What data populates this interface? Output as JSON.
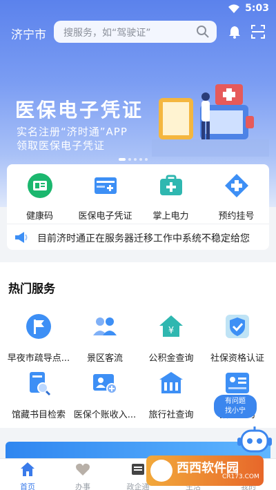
{
  "status_bar": {
    "time": "5:03"
  },
  "header": {
    "city": "济宁市",
    "search_placeholder": "搜服务，如“驾驶证”"
  },
  "banner": {
    "title": "医保电子凭证",
    "line1": "实名注册“济时通”APP",
    "line2": "领取医保电子凭证"
  },
  "quick_actions": [
    {
      "label": "健康码",
      "icon": "health-code-icon",
      "color": "#1bb76e"
    },
    {
      "label": "医保电子凭证",
      "icon": "medical-card-icon",
      "color": "#3d8ff5"
    },
    {
      "label": "掌上电力",
      "icon": "power-kit-icon",
      "color": "#2fb7b0"
    },
    {
      "label": "预约挂号",
      "icon": "appointment-cross-icon",
      "color": "#3d8ff5"
    }
  ],
  "notice": {
    "text": "目前济时通正在服务器迁移工作中系统不稳定给您"
  },
  "hot_services": {
    "title": "热门服务",
    "items": [
      {
        "label": "早夜市疏导点...",
        "icon": "flag-icon"
      },
      {
        "label": "景区客流",
        "icon": "people-icon"
      },
      {
        "label": "公积金查询",
        "icon": "house-fund-icon"
      },
      {
        "label": "社保资格认证",
        "icon": "shield-check-icon"
      },
      {
        "label": "馆藏书目检索",
        "icon": "book-search-icon"
      },
      {
        "label": "医保个账收入...",
        "icon": "user-add-card-icon"
      },
      {
        "label": "旅行社查询",
        "icon": "building-icon"
      },
      {
        "label": "招...查询",
        "icon": "id-card-icon"
      }
    ]
  },
  "assistant": {
    "line1": "有问题",
    "line2": "找小宁"
  },
  "tabs": [
    {
      "label": "首页",
      "icon": "home-icon",
      "active": true
    },
    {
      "label": "办事",
      "icon": "heart-icon",
      "active": false
    },
    {
      "label": "政企通",
      "icon": "news-icon",
      "active": false
    },
    {
      "label": "生活",
      "icon": "life-icon",
      "active": false
    },
    {
      "label": "我的",
      "icon": "user-icon",
      "active": false
    }
  ],
  "watermark": {
    "brand": "西西软件园",
    "url": "CR173.COM"
  },
  "colors": {
    "primary": "#3a7bea",
    "hero_top": "#5b82ec",
    "text": "#222222"
  }
}
